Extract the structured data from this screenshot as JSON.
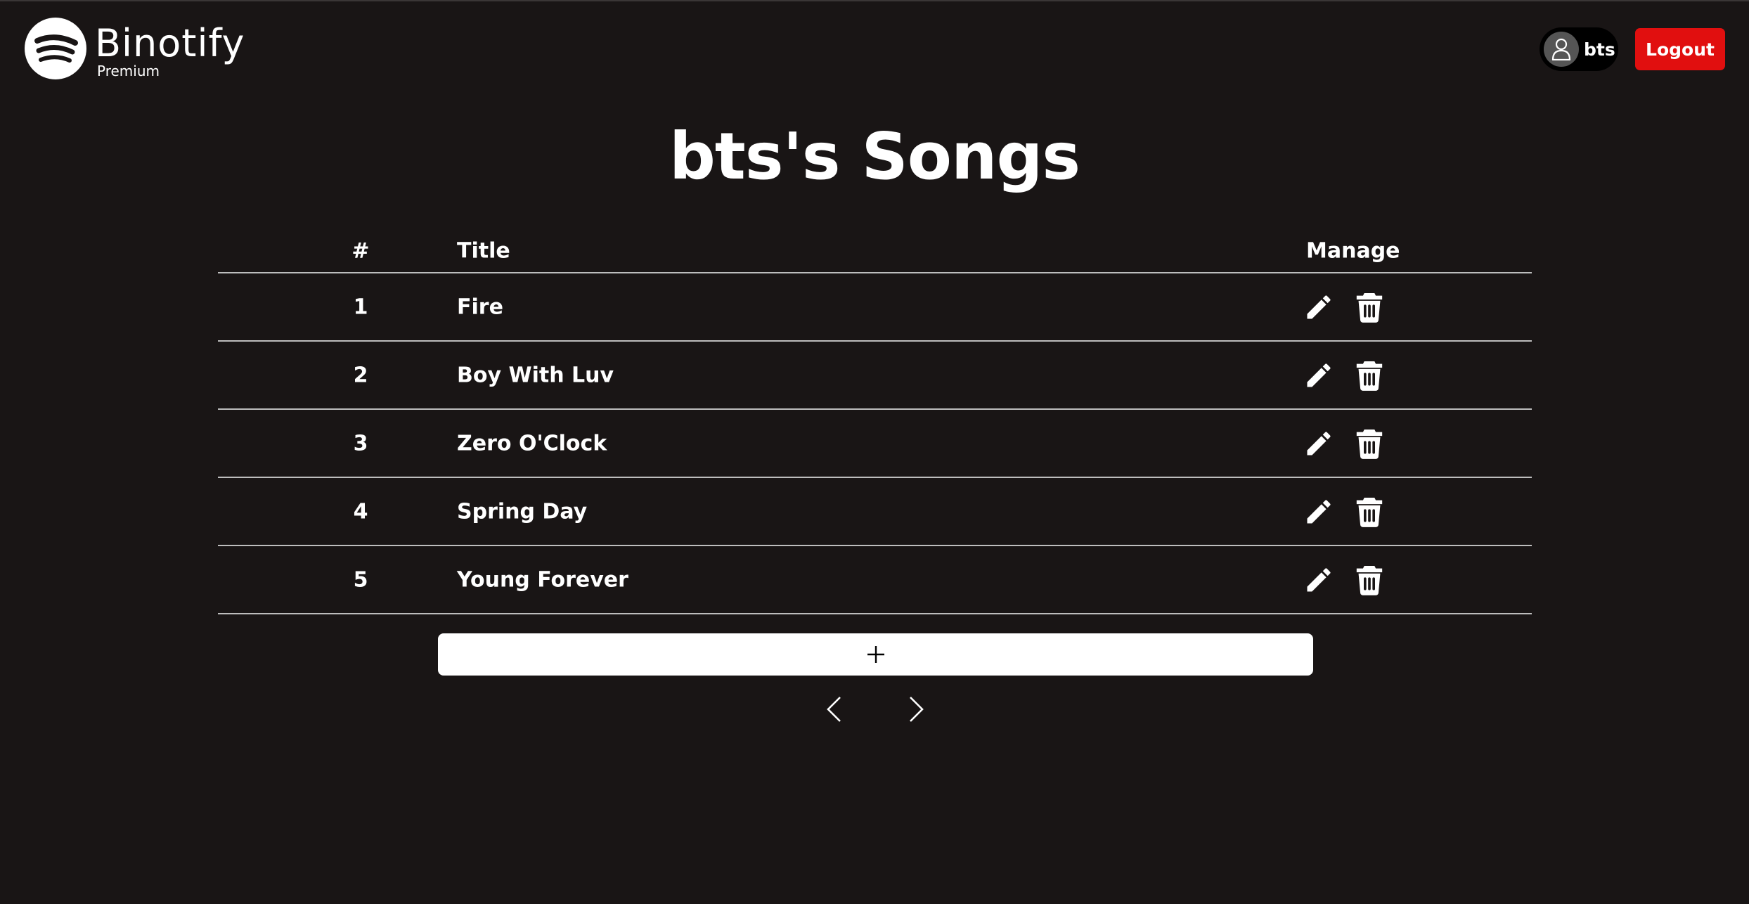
{
  "header": {
    "brand": "Binotify",
    "tier": "Premium",
    "username": "bts",
    "logout_label": "Logout"
  },
  "page_title": "bts's Songs",
  "table": {
    "columns": [
      "#",
      "Title",
      "Manage"
    ],
    "rows": [
      {
        "number": "1",
        "title": "Fire"
      },
      {
        "number": "2",
        "title": "Boy With Luv"
      },
      {
        "number": "3",
        "title": "Zero O'Clock"
      },
      {
        "number": "4",
        "title": "Spring Day"
      },
      {
        "number": "5",
        "title": "Young Forever"
      }
    ]
  },
  "icons": {
    "logo": "spotify-logo-icon",
    "avatar": "user-icon",
    "edit": "pencil-icon",
    "delete": "trash-icon",
    "add": "plus-icon",
    "prev": "chevron-left-icon",
    "next": "chevron-right-icon"
  },
  "colors": {
    "background": "#191515",
    "logout": "#e10f0f",
    "text": "#ffffff"
  }
}
